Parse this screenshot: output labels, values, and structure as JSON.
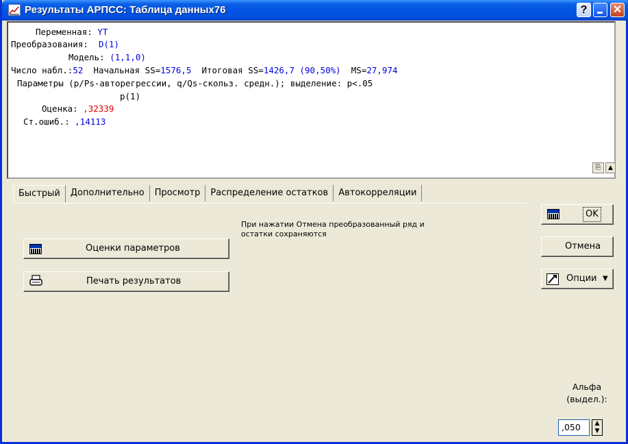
{
  "window": {
    "title": "Результаты АРПСС: Таблица данных76",
    "help_glyph": "?",
    "close_glyph": "✕"
  },
  "output": {
    "variable_label": "Переменная:",
    "variable_value": "YT",
    "transform_label": "Преобразования:",
    "transform_value": "D(1)",
    "model_label": "Модель:",
    "model_value": "(1,1,0)",
    "nobs_label": "Число набл.:",
    "nobs_value": "52",
    "initial_ss_label": "Начальная SS=",
    "initial_ss_value": "1576,5",
    "final_ss_label": "Итоговая SS=",
    "final_ss_value": "1426,7 (90,50%)",
    "ms_label": "MS=",
    "ms_value": "27,974",
    "params_line": "Параметры (p/Ps-авторегрессии, q/Qs-скольз. средн.); выделение: p<.05",
    "param_header": "p(1)",
    "estimate_label": "Оценка:",
    "estimate_value": ",32339",
    "stderr_label": "Ст.ошиб.:",
    "stderr_value": ",14113",
    "copy_glyph": "⎘",
    "expand_glyph": "▲"
  },
  "tabs": [
    {
      "label": "Быстрый",
      "active": true
    },
    {
      "label": "Дополнительно",
      "active": false
    },
    {
      "label": "Просмотр",
      "active": false
    },
    {
      "label": "Распределение остатков",
      "active": false
    },
    {
      "label": "Автокорреляции",
      "active": false
    }
  ],
  "quick_tab": {
    "estimates_button": "Оценки параметров",
    "print_button": "Печать результатов",
    "note": "При нажатии Отмена преобразованный ряд и остатки сохраняются"
  },
  "side": {
    "ok_label": "OK",
    "cancel_label": "Отмена",
    "options_label": "Опции",
    "options_arrow": "▼",
    "alpha_label_1": "Альфа",
    "alpha_label_2": "(выдел.):",
    "alpha_value": ",050",
    "spin_up": "▲",
    "spin_down": "▼"
  },
  "colors": {
    "value_blue": "#0000e0",
    "value_red": "#e00000",
    "title_bar": "#0053e1",
    "dialog_bg": "#ece9d8"
  }
}
